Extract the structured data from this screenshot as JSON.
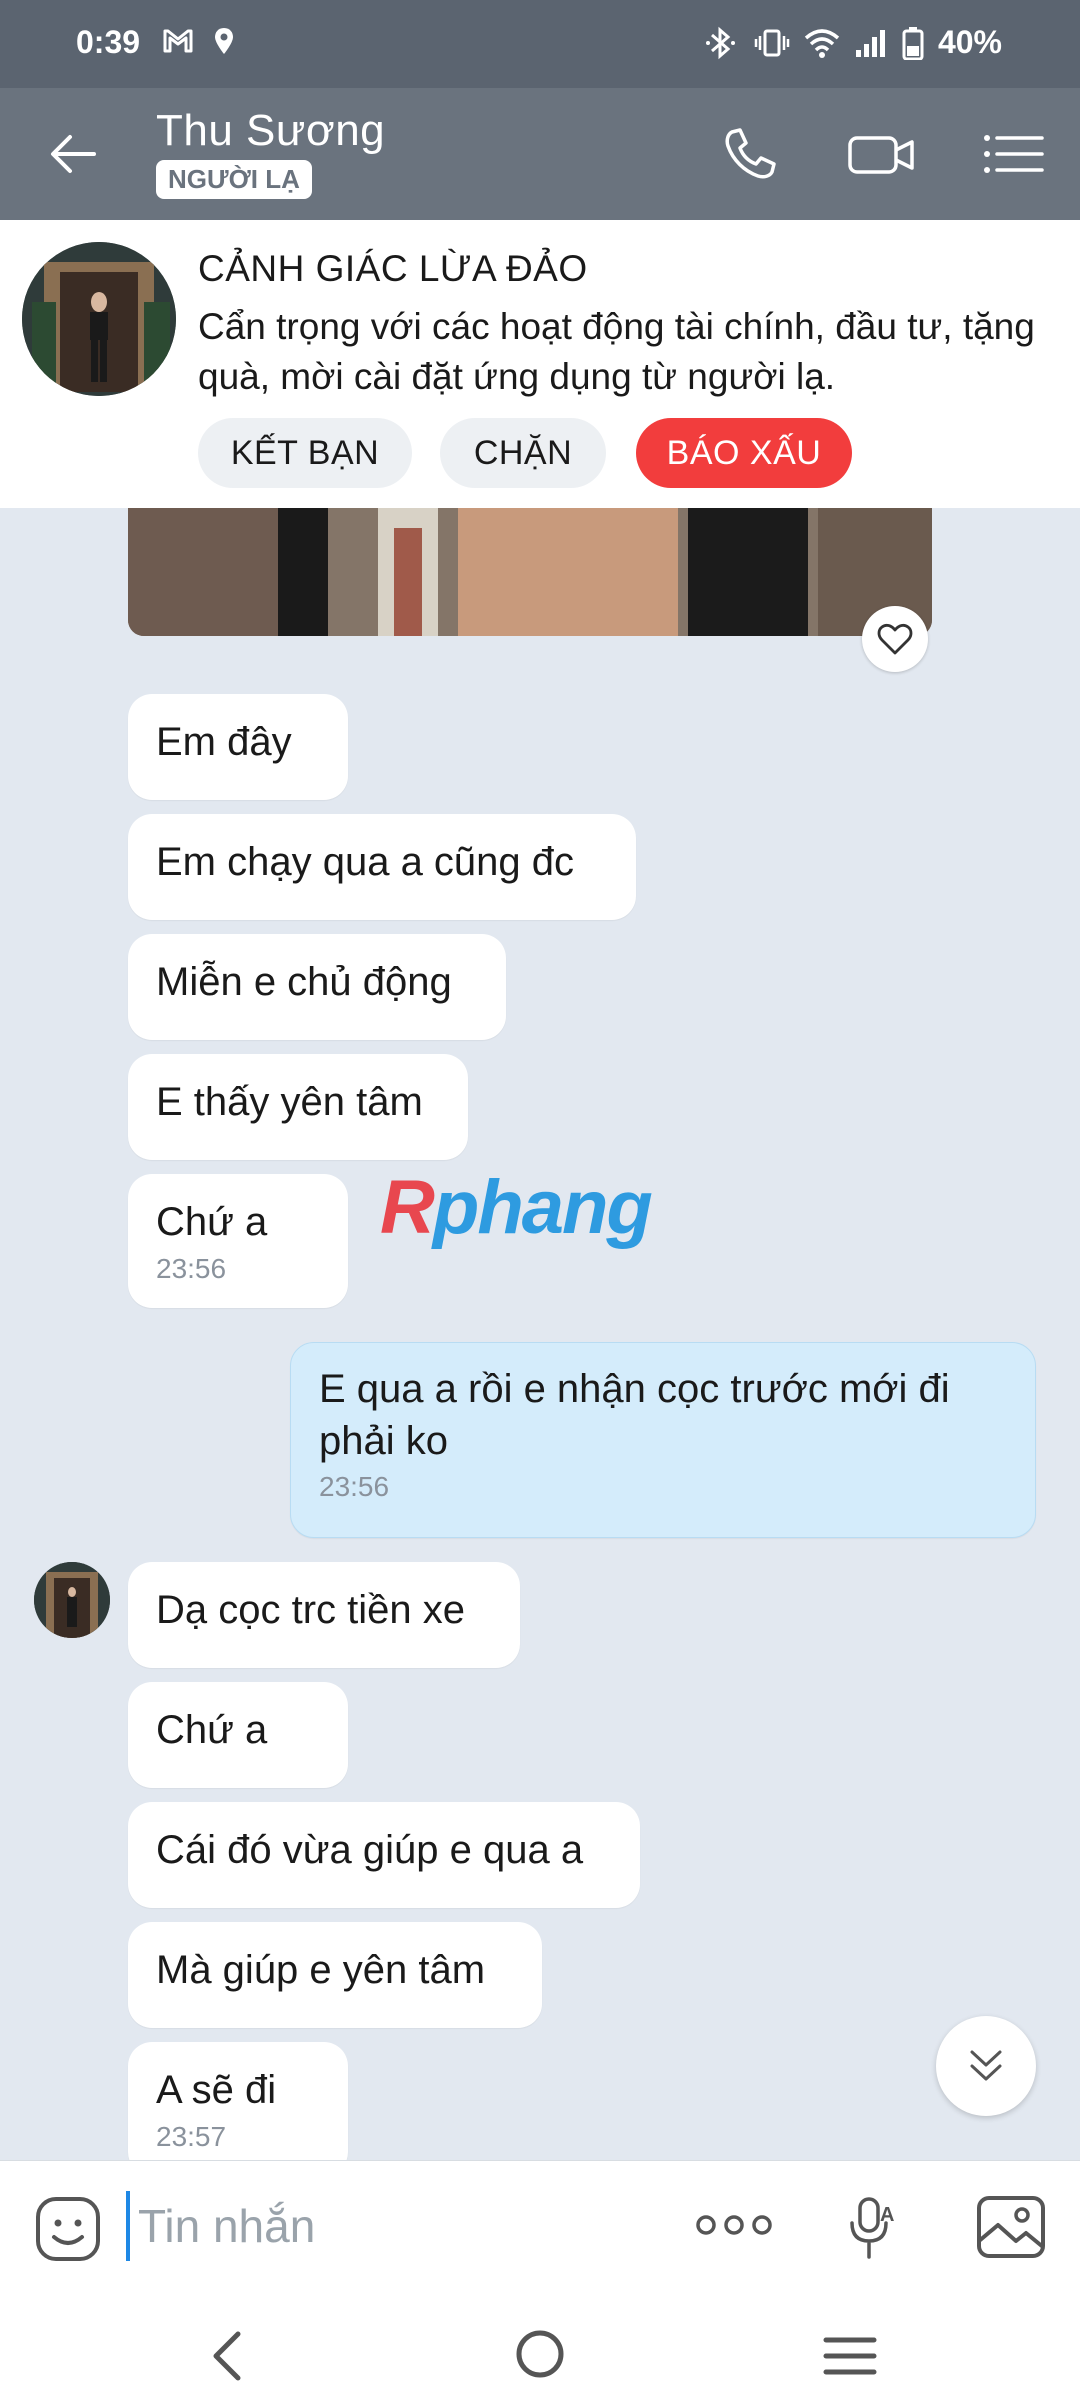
{
  "status_bar": {
    "time": "0:39",
    "battery": "40%"
  },
  "header": {
    "contact_name": "Thu Sương",
    "badge": "NGƯỜI LẠ"
  },
  "warning": {
    "title": "CẢNH GIÁC LỪA ĐẢO",
    "text": "Cẩn trọng với các hoạt động tài chính, đầu tư, tặng quà, mời cài đặt ứng dụng từ người lạ.",
    "buttons": {
      "add_friend": "KẾT BẠN",
      "block": "CHẶN",
      "report": "BÁO XẤU"
    }
  },
  "messages": [
    {
      "text": "Em đây"
    },
    {
      "text": "Em chạy qua a cũng đc"
    },
    {
      "text": "Miễn e chủ động"
    },
    {
      "text": "E thấy yên tâm"
    },
    {
      "text": "Chứ a",
      "time": "23:56"
    },
    {
      "text": "E qua a rồi e nhận cọc trước mới đi phải ko",
      "time": "23:56"
    },
    {
      "text": "Dạ cọc trc tiền xe"
    },
    {
      "text": "Chứ a"
    },
    {
      "text": "Cái đó vừa giúp e qua a"
    },
    {
      "text": "Mà giúp e yên tâm"
    },
    {
      "text": "A sẽ đi",
      "time": "23:57"
    }
  ],
  "watermark": "Rphang",
  "input": {
    "placeholder": "Tin nhắn"
  },
  "colors": {
    "header_bg": "#6a737e",
    "report_red": "#f23d3d",
    "mine_bubble": "#d4ecfb",
    "chat_bg": "#e2e8f0"
  }
}
